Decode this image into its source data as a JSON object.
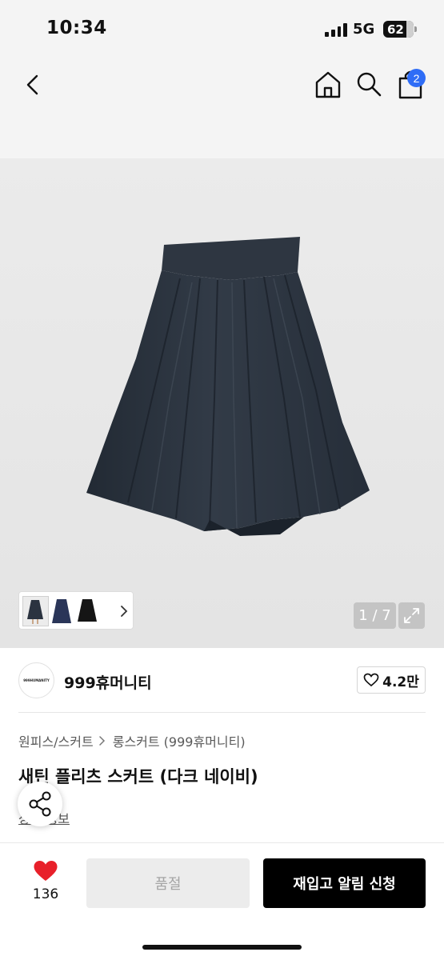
{
  "status_bar": {
    "time": "10:34",
    "network": "5G",
    "battery": "62"
  },
  "header": {
    "icons": [
      "back-icon",
      "home-icon",
      "search-icon",
      "shopping-bag-icon"
    ],
    "cart_badge": "2"
  },
  "gallery": {
    "counter": "1 / 7",
    "thumbnail_colors": [
      "#2b3340",
      "#2a3558",
      "#151515"
    ],
    "product_color": "#2c333d"
  },
  "brand": {
    "logo_text": "999HUMANITY",
    "name": "999휴머니티",
    "likes": "4.2만"
  },
  "product": {
    "breadcrumb": [
      "원피스/스커트",
      "롱스커트 (999휴머니티)"
    ],
    "title": "새틴 플리츠 스커트 (다크 네이비)",
    "detail_link": "상세 정보"
  },
  "bottom_bar": {
    "wish_count": "136",
    "soldout_label": "품절",
    "restock_label": "재입고 알림 신청",
    "heart_color": "#e8202a"
  }
}
